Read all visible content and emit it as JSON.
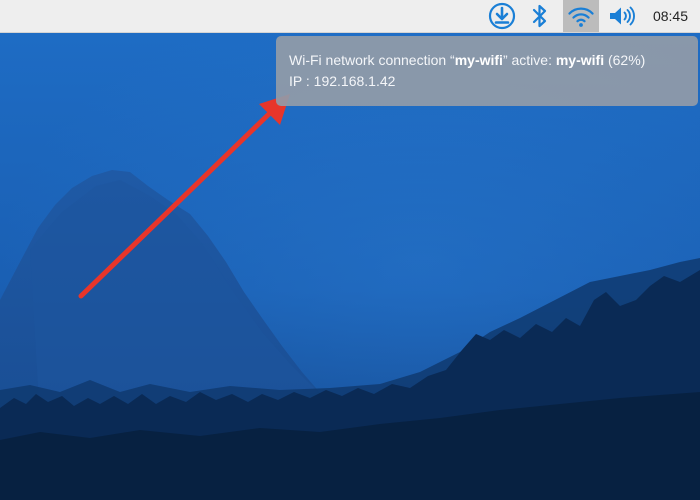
{
  "taskbar": {
    "icons": [
      {
        "name": "download-icon",
        "tooltip": ""
      },
      {
        "name": "bluetooth-icon",
        "tooltip": ""
      },
      {
        "name": "wifi-icon",
        "tooltip": ""
      },
      {
        "name": "volume-icon",
        "tooltip": ""
      }
    ],
    "clock": "08:45"
  },
  "tooltip": {
    "prefix": "Wi-Fi network connection “",
    "ssid_quoted": "my-wifi",
    "middle": "” active: ",
    "ssid_active": "my-wifi",
    "strength": " (62%)",
    "ip_label": "IP : ",
    "ip_address": "192.168.1.42"
  },
  "colors": {
    "taskbar_bg": "#eeeeee",
    "icon_blue": "#1a7fd6",
    "active_icon_bg": "#bcbcbc",
    "tooltip_bg": "#919ba8",
    "arrow": "#e8352a",
    "sky": "#1c67c0"
  }
}
